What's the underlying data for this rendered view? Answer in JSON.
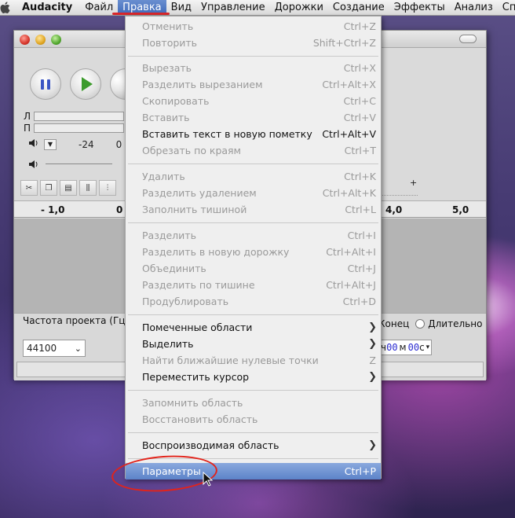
{
  "menubar": {
    "app": "Audacity",
    "items": [
      "Файл",
      "Правка",
      "Вид",
      "Управление",
      "Дорожки",
      "Создание",
      "Эффекты",
      "Анализ",
      "Спра"
    ]
  },
  "window": {
    "meters": {
      "left": "Л",
      "right": "П",
      "level_minus24": "-24",
      "level_0": "0"
    },
    "ruler": {
      "l1": "- 1,0",
      "l2": "0",
      "l3": "4,0",
      "l4": "5,0"
    },
    "project_rate_label": "Частота проекта (Гц):",
    "project_rate_value": "44100",
    "selection_end": "Конец",
    "selection_length": "Длительно",
    "time_value": {
      "h": "ч",
      "m1": "00",
      "m": "м",
      "s1": "00",
      "s": "с"
    }
  },
  "menu": {
    "undo": {
      "label": "Отменить",
      "shortcut": "Ctrl+Z"
    },
    "redo": {
      "label": "Повторить",
      "shortcut": "Shift+Ctrl+Z"
    },
    "cut": {
      "label": "Вырезать",
      "shortcut": "Ctrl+X"
    },
    "split_cut": {
      "label": "Разделить вырезанием",
      "shortcut": "Ctrl+Alt+X"
    },
    "copy": {
      "label": "Скопировать",
      "shortcut": "Ctrl+C"
    },
    "paste": {
      "label": "Вставить",
      "shortcut": "Ctrl+V"
    },
    "paste_text_label": {
      "label": "Вставить текст в новую пометку",
      "shortcut": "Ctrl+Alt+V"
    },
    "trim": {
      "label": "Обрезать по краям",
      "shortcut": "Ctrl+T"
    },
    "delete": {
      "label": "Удалить",
      "shortcut": "Ctrl+K"
    },
    "split_delete": {
      "label": "Разделить удалением",
      "shortcut": "Ctrl+Alt+K"
    },
    "silence": {
      "label": "Заполнить тишиной",
      "shortcut": "Ctrl+L"
    },
    "split": {
      "label": "Разделить",
      "shortcut": "Ctrl+I"
    },
    "split_new": {
      "label": "Разделить в новую дорожку",
      "shortcut": "Ctrl+Alt+I"
    },
    "join": {
      "label": "Объединить",
      "shortcut": "Ctrl+J"
    },
    "detach_silence": {
      "label": "Разделить по тишине",
      "shortcut": "Ctrl+Alt+J"
    },
    "duplicate": {
      "label": "Продублировать",
      "shortcut": "Ctrl+D"
    },
    "labeled_regions": {
      "label": "Помеченные области"
    },
    "select": {
      "label": "Выделить"
    },
    "find_zero": {
      "label": "Найти ближайшие нулевые точки",
      "shortcut": "Z"
    },
    "move_cursor": {
      "label": "Переместить курсор"
    },
    "save_selection": {
      "label": "Запомнить область"
    },
    "restore_selection": {
      "label": "Восстановить область"
    },
    "play_region": {
      "label": "Воспроизводимая область"
    },
    "preferences": {
      "label": "Параметры",
      "shortcut": "Ctrl+P"
    }
  }
}
